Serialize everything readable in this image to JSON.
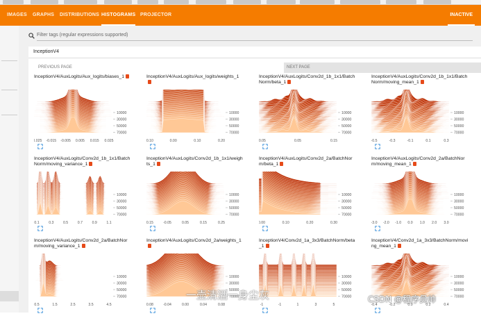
{
  "nav": {
    "tabs": [
      {
        "label": "IMAGES",
        "active": false
      },
      {
        "label": "GRAPHS",
        "active": false
      },
      {
        "label": "DISTRIBUTIONS",
        "active": false
      },
      {
        "label": "HISTOGRAMS",
        "active": true
      },
      {
        "label": "PROJECTOR",
        "active": false
      }
    ],
    "status": "INACTIVE",
    "bar_color": "#f57c00"
  },
  "filter": {
    "placeholder": "Filter tags (regular expressions supported)"
  },
  "group": {
    "name": "InceptionV4"
  },
  "pager": {
    "prev": "PREVIOUS PAGE",
    "next": "NEXT PAGE"
  },
  "accent": "#e64a19",
  "histograms": [
    {
      "title": "InceptionV4/AuxLogits/Aux_logits/biases_1",
      "xticks": [
        "-0.025",
        "-0.015",
        "-0.005",
        "0.005",
        "0.015",
        "0.025"
      ],
      "yticks": [
        "10000",
        "30000",
        "50000",
        "70000"
      ],
      "shape": "spike"
    },
    {
      "title": "InceptionV4/AuxLogits/Aux_logits/weights_1",
      "xticks": [
        "-0.10",
        "0.00",
        "0.10",
        "0.20"
      ],
      "yticks": [
        "10000",
        "30000",
        "50000",
        "70000"
      ],
      "shape": "plateau"
    },
    {
      "title": "InceptionV4/AuxLogits/Conv2d_1b_1x1/BatchNorm/beta_1",
      "xticks": [
        "-0.05",
        "0.05",
        "0.15"
      ],
      "yticks": [
        "10000",
        "30000",
        "50000",
        "70000"
      ],
      "shape": "spike-wide"
    },
    {
      "title": "InceptionV4/AuxLogits/Conv2d_1b_1x1/BatchNorm/moving_mean_1",
      "xticks": [
        "-0.5",
        "-0.3",
        "-0.1",
        "0.1",
        "0.3"
      ],
      "yticks": [
        "10000",
        "30000",
        "50000",
        "70000"
      ],
      "shape": "spike-wide"
    },
    {
      "title": "InceptionV4/AuxLogits/Conv2d_1b_1x1/BatchNorm/moving_variance_1",
      "xticks": [
        "0.1",
        "0.3",
        "0.5",
        "0.7",
        "0.9",
        "1.1"
      ],
      "yticks": [
        "10000",
        "30000",
        "50000",
        "70000"
      ],
      "shape": "multi"
    },
    {
      "title": "InceptionV4/AuxLogits/Conv2d_1b_1x1/weights_1",
      "xticks": [
        "-0.15",
        "-0.05",
        "0.05",
        "0.15",
        "0.25"
      ],
      "yticks": [
        "10000",
        "30000",
        "50000",
        "70000"
      ],
      "shape": "bell"
    },
    {
      "title": "InceptionV4/AuxLogits/Conv2d_2a/BatchNorm/beta_1",
      "xticks": [
        "0.00",
        "0.10",
        "0.20",
        "0.30"
      ],
      "yticks": [
        "10000",
        "30000",
        "50000",
        "70000"
      ],
      "shape": "decay"
    },
    {
      "title": "InceptionV4/AuxLogits/Conv2d_2a/BatchNorm/moving_mean_1",
      "xticks": [
        "-3.0",
        "-2.0",
        "-1.0",
        "0.0",
        "1.0",
        "2.0",
        "3.0"
      ],
      "yticks": [
        "10000",
        "30000",
        "50000",
        "70000"
      ],
      "shape": "spike"
    },
    {
      "title": "InceptionV4/AuxLogits/Conv2d_2a/BatchNorm/moving_variance_1",
      "xticks": [
        "0.5",
        "1.5",
        "2.5",
        "3.5",
        "4.5"
      ],
      "yticks": [
        "10000",
        "30000",
        "50000",
        "70000"
      ],
      "shape": "left-spike"
    },
    {
      "title": "InceptionV4/AuxLogits/Conv2d_2a/weights_1",
      "xticks": [
        "-0.08",
        "-0.04",
        "0.00",
        "0.04",
        "0.08"
      ],
      "yticks": [
        "10000",
        "30000",
        "50000",
        "70000"
      ],
      "shape": "bell-tall"
    },
    {
      "title": "InceptionV4/Conv2d_1a_3x3/BatchNorm/beta_1",
      "xticks": [
        "-1",
        "-1",
        "1",
        "3",
        "5"
      ],
      "yticks": [
        "10000",
        "30000",
        "50000",
        "70000"
      ],
      "shape": "multi-spike"
    },
    {
      "title": "InceptionV4/Conv2d_1a_3x3/BatchNorm/moving_mean_1",
      "xticks": [
        "-0.4",
        "-0.2",
        "0.0",
        "0.2",
        "0.4"
      ],
      "yticks": [
        "10000",
        "30000",
        "50000",
        "70000"
      ],
      "shape": "spike-wide"
    }
  ],
  "watermark": "一壶清酒一身尘灰",
  "credit": "CSDN @程序员帅"
}
